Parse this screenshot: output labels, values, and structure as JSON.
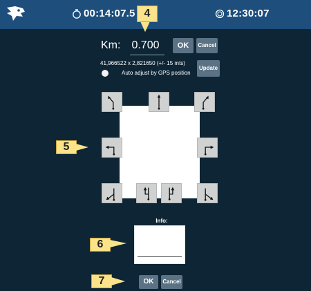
{
  "header": {
    "elapsed_time": "00:14:07.5",
    "clock_time": "12:30:07",
    "background_color": "#1d4e7c"
  },
  "odometer": {
    "label": "Km:",
    "value": "0.700",
    "ok_label": "OK",
    "cancel_label": "Cancel"
  },
  "gps": {
    "coordinates": "41,966522 x 2,821650 (+/- 15 mts)",
    "auto_adjust_label": "Auto adjust by GPS position",
    "update_label": "Update"
  },
  "directions": {
    "tiles": [
      "turn-slight-left-icon",
      "straight-icon",
      "turn-slight-right-icon",
      "turn-left-icon",
      "turn-right-icon",
      "fork-sharp-left-icon",
      "keep-left-icon",
      "keep-right-icon",
      "fork-sharp-right-icon"
    ]
  },
  "info": {
    "label": "Info:",
    "ok_label": "OK",
    "cancel_label": "Cancel"
  },
  "callouts": {
    "c4": "4",
    "c5": "5",
    "c6": "6",
    "c7": "7",
    "color": "#fbe38a"
  },
  "theme": {
    "panel_background": "#0d2535",
    "button_color": "#5a7284",
    "tile_color": "#d0d1d1"
  }
}
